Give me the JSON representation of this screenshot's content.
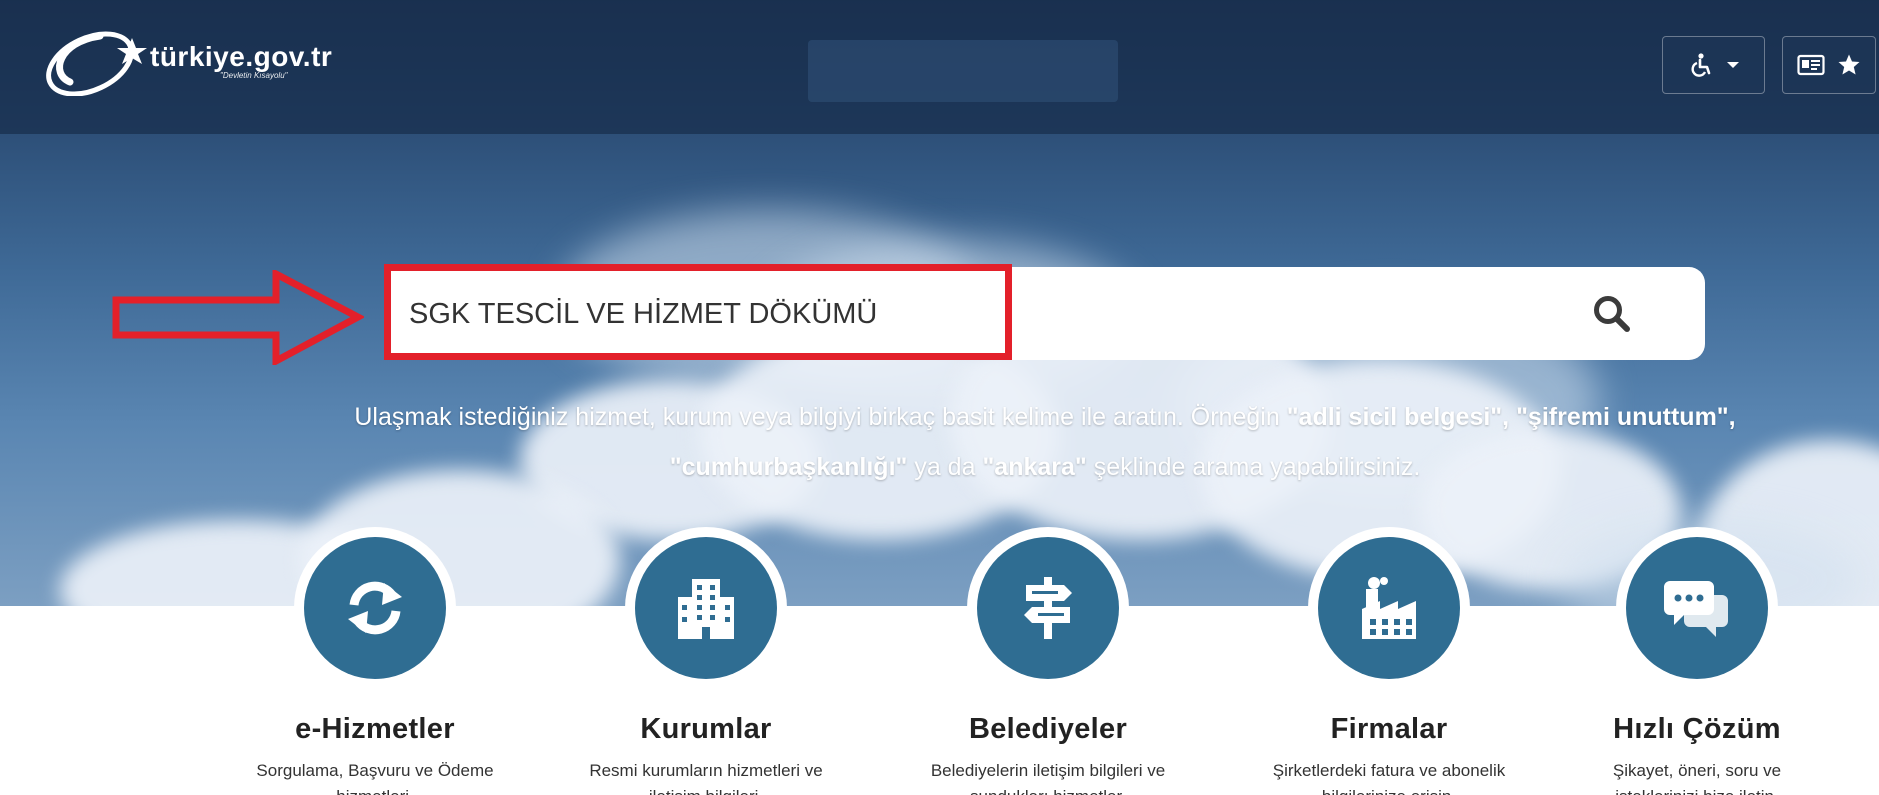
{
  "brand": {
    "name": "türkiye.gov.tr",
    "tagline": "\"Devletin Kısayolu\""
  },
  "header": {
    "accessibility_icon": "wheelchair-icon",
    "dropdown_icon": "caret-down-icon",
    "ecard_icon": "id-card-icon",
    "favorites_icon": "star-icon"
  },
  "search": {
    "value": "SGK TESCİL VE HİZMET DÖKÜMÜ",
    "icon": "search-icon"
  },
  "hint": {
    "part1": "Ulaşmak istediğiniz hizmet, kurum veya bilgiyi birkaç basit kelime ile aratın. Örneğin ",
    "ex1": "\"adli sicil belgesi\"",
    "sep1": ", ",
    "ex2": "\"şifremi unuttum\"",
    "sep2": ", ",
    "ex3": "\"cumhurbaşkanlığı\"",
    "part2": " ya da ",
    "ex4": "\"ankara\"",
    "part3": " şeklinde arama yapabilirsiniz."
  },
  "categories": [
    {
      "title": "e-Hizmetler",
      "desc_line1": "Sorgulama, Başvuru ve Ödeme",
      "desc_line2": "hizmetleri.",
      "icon": "refresh-icon"
    },
    {
      "title": "Kurumlar",
      "desc_line1": "Resmi kurumların hizmetleri ve",
      "desc_line2": "iletişim bilgileri.",
      "icon": "building-icon"
    },
    {
      "title": "Belediyeler",
      "desc_line1": "Belediyelerin iletişim bilgileri ve",
      "desc_line2": "sundukları hizmetler.",
      "icon": "signpost-icon"
    },
    {
      "title": "Firmalar",
      "desc_line1": "Şirketlerdeki fatura ve abonelik",
      "desc_line2": "bilgilerinize erişin.",
      "icon": "factory-icon"
    },
    {
      "title": "Hızlı Çözüm",
      "desc_line1": "Şikayet, öneri, soru ve",
      "desc_line2": "isteklerinizi bize iletin.",
      "icon": "chat-bubbles-icon"
    }
  ],
  "colors": {
    "header_bg": "#1f3658",
    "category_circle": "#2f6d92",
    "annotation_red": "#e3202a"
  }
}
